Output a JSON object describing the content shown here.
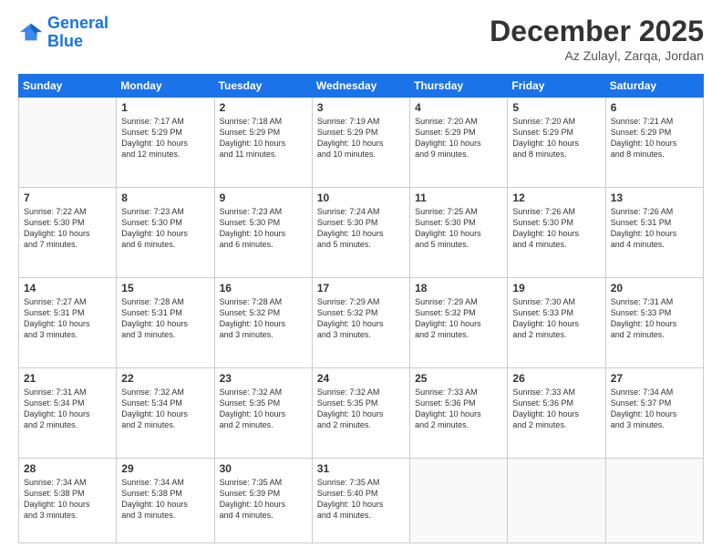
{
  "logo": {
    "line1": "General",
    "line2": "Blue"
  },
  "title": "December 2025",
  "location": "Az Zulayl, Zarqa, Jordan",
  "days_header": [
    "Sunday",
    "Monday",
    "Tuesday",
    "Wednesday",
    "Thursday",
    "Friday",
    "Saturday"
  ],
  "weeks": [
    [
      {
        "num": "",
        "info": ""
      },
      {
        "num": "1",
        "info": "Sunrise: 7:17 AM\nSunset: 5:29 PM\nDaylight: 10 hours\nand 12 minutes."
      },
      {
        "num": "2",
        "info": "Sunrise: 7:18 AM\nSunset: 5:29 PM\nDaylight: 10 hours\nand 11 minutes."
      },
      {
        "num": "3",
        "info": "Sunrise: 7:19 AM\nSunset: 5:29 PM\nDaylight: 10 hours\nand 10 minutes."
      },
      {
        "num": "4",
        "info": "Sunrise: 7:20 AM\nSunset: 5:29 PM\nDaylight: 10 hours\nand 9 minutes."
      },
      {
        "num": "5",
        "info": "Sunrise: 7:20 AM\nSunset: 5:29 PM\nDaylight: 10 hours\nand 8 minutes."
      },
      {
        "num": "6",
        "info": "Sunrise: 7:21 AM\nSunset: 5:29 PM\nDaylight: 10 hours\nand 8 minutes."
      }
    ],
    [
      {
        "num": "7",
        "info": "Sunrise: 7:22 AM\nSunset: 5:30 PM\nDaylight: 10 hours\nand 7 minutes."
      },
      {
        "num": "8",
        "info": "Sunrise: 7:23 AM\nSunset: 5:30 PM\nDaylight: 10 hours\nand 6 minutes."
      },
      {
        "num": "9",
        "info": "Sunrise: 7:23 AM\nSunset: 5:30 PM\nDaylight: 10 hours\nand 6 minutes."
      },
      {
        "num": "10",
        "info": "Sunrise: 7:24 AM\nSunset: 5:30 PM\nDaylight: 10 hours\nand 5 minutes."
      },
      {
        "num": "11",
        "info": "Sunrise: 7:25 AM\nSunset: 5:30 PM\nDaylight: 10 hours\nand 5 minutes."
      },
      {
        "num": "12",
        "info": "Sunrise: 7:26 AM\nSunset: 5:30 PM\nDaylight: 10 hours\nand 4 minutes."
      },
      {
        "num": "13",
        "info": "Sunrise: 7:26 AM\nSunset: 5:31 PM\nDaylight: 10 hours\nand 4 minutes."
      }
    ],
    [
      {
        "num": "14",
        "info": "Sunrise: 7:27 AM\nSunset: 5:31 PM\nDaylight: 10 hours\nand 3 minutes."
      },
      {
        "num": "15",
        "info": "Sunrise: 7:28 AM\nSunset: 5:31 PM\nDaylight: 10 hours\nand 3 minutes."
      },
      {
        "num": "16",
        "info": "Sunrise: 7:28 AM\nSunset: 5:32 PM\nDaylight: 10 hours\nand 3 minutes."
      },
      {
        "num": "17",
        "info": "Sunrise: 7:29 AM\nSunset: 5:32 PM\nDaylight: 10 hours\nand 3 minutes."
      },
      {
        "num": "18",
        "info": "Sunrise: 7:29 AM\nSunset: 5:32 PM\nDaylight: 10 hours\nand 2 minutes."
      },
      {
        "num": "19",
        "info": "Sunrise: 7:30 AM\nSunset: 5:33 PM\nDaylight: 10 hours\nand 2 minutes."
      },
      {
        "num": "20",
        "info": "Sunrise: 7:31 AM\nSunset: 5:33 PM\nDaylight: 10 hours\nand 2 minutes."
      }
    ],
    [
      {
        "num": "21",
        "info": "Sunrise: 7:31 AM\nSunset: 5:34 PM\nDaylight: 10 hours\nand 2 minutes."
      },
      {
        "num": "22",
        "info": "Sunrise: 7:32 AM\nSunset: 5:34 PM\nDaylight: 10 hours\nand 2 minutes."
      },
      {
        "num": "23",
        "info": "Sunrise: 7:32 AM\nSunset: 5:35 PM\nDaylight: 10 hours\nand 2 minutes."
      },
      {
        "num": "24",
        "info": "Sunrise: 7:32 AM\nSunset: 5:35 PM\nDaylight: 10 hours\nand 2 minutes."
      },
      {
        "num": "25",
        "info": "Sunrise: 7:33 AM\nSunset: 5:36 PM\nDaylight: 10 hours\nand 2 minutes."
      },
      {
        "num": "26",
        "info": "Sunrise: 7:33 AM\nSunset: 5:36 PM\nDaylight: 10 hours\nand 2 minutes."
      },
      {
        "num": "27",
        "info": "Sunrise: 7:34 AM\nSunset: 5:37 PM\nDaylight: 10 hours\nand 3 minutes."
      }
    ],
    [
      {
        "num": "28",
        "info": "Sunrise: 7:34 AM\nSunset: 5:38 PM\nDaylight: 10 hours\nand 3 minutes."
      },
      {
        "num": "29",
        "info": "Sunrise: 7:34 AM\nSunset: 5:38 PM\nDaylight: 10 hours\nand 3 minutes."
      },
      {
        "num": "30",
        "info": "Sunrise: 7:35 AM\nSunset: 5:39 PM\nDaylight: 10 hours\nand 4 minutes."
      },
      {
        "num": "31",
        "info": "Sunrise: 7:35 AM\nSunset: 5:40 PM\nDaylight: 10 hours\nand 4 minutes."
      },
      {
        "num": "",
        "info": ""
      },
      {
        "num": "",
        "info": ""
      },
      {
        "num": "",
        "info": ""
      }
    ]
  ]
}
